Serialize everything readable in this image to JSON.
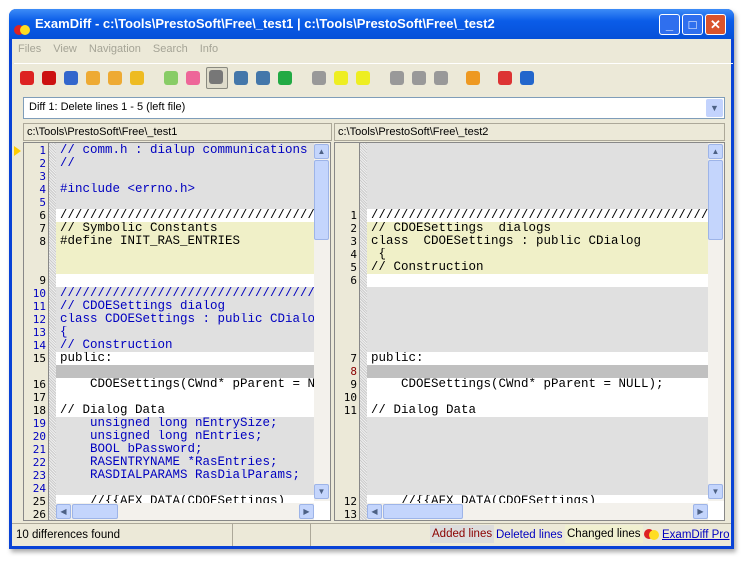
{
  "title": "ExamDiff - c:\\Tools\\PrestoSoft\\Free\\_test1   |   c:\\Tools\\PrestoSoft\\Free\\_test2",
  "menu": [
    "Files",
    "View",
    "Navigation",
    "Search",
    "Info"
  ],
  "toolbar": [
    "open-files-icon",
    "cherries-icon",
    "swap-icon",
    "edit-left-icon",
    "edit-right-icon",
    "save-icon",
    "layout-1-icon",
    "layout-2-icon",
    "layout-split-vertical-icon",
    "layout-split-horizontal-icon",
    "layout-4-icon",
    "colors-icon",
    "first-diff-icon",
    "current-diff-icon",
    "next-diff-icon",
    "find-icon",
    "find-next-icon",
    "find-prev-icon",
    "options-icon",
    "exit-icon",
    "info-icon"
  ],
  "diff_combo": "Diff 1: Delete lines 1 - 5 (left file)",
  "left_header": "c:\\Tools\\PrestoSoft\\Free\\_test1",
  "right_header": "c:\\Tools\\PrestoSoft\\Free\\_test2",
  "colors": {
    "deleted": "#e0e0e0",
    "changed": "#f0f0c8",
    "normal": "#ffffff",
    "placeholder": "#c0c0c0",
    "deleted_text": "#0000c0",
    "added_text": "#8b0000"
  },
  "left_rows": [
    [
      "1",
      "// comm.h : dialup communications",
      "del"
    ],
    [
      "2",
      "//",
      "del"
    ],
    [
      "3",
      "",
      "del"
    ],
    [
      "4",
      "#include <errno.h>",
      "del"
    ],
    [
      "5",
      "",
      "del"
    ],
    [
      "6",
      "////////////////////////////////////////",
      "norm"
    ],
    [
      "7",
      "// Symbolic Constants",
      "chg"
    ],
    [
      "8",
      "#define INIT_RAS_ENTRIES",
      "chg"
    ],
    [
      "",
      "",
      "chg"
    ],
    [
      "",
      "",
      "chg"
    ],
    [
      "9",
      "",
      "norm"
    ],
    [
      "10",
      "////////////////////////////////////////",
      "del"
    ],
    [
      "11",
      "// CDOESettings dialog",
      "del"
    ],
    [
      "12",
      "class CDOESettings : public CDialog",
      "del"
    ],
    [
      "13",
      "{",
      "del"
    ],
    [
      "14",
      "// Construction",
      "del"
    ],
    [
      "15",
      "public:",
      "norm"
    ],
    [
      "",
      "",
      "ph"
    ],
    [
      "16",
      "    CDOESettings(CWnd* pParent = NULL);",
      "norm"
    ],
    [
      "17",
      "",
      "norm"
    ],
    [
      "18",
      "// Dialog Data",
      "norm"
    ],
    [
      "19",
      "    unsigned long nEntrySize;",
      "del"
    ],
    [
      "20",
      "    unsigned long nEntries;",
      "del"
    ],
    [
      "21",
      "    BOOL bPassword;",
      "del"
    ],
    [
      "22",
      "    RASENTRYNAME *RasEntries;",
      "del"
    ],
    [
      "23",
      "    RASDIALPARAMS RasDialParams;",
      "del"
    ],
    [
      "24",
      "",
      "del"
    ],
    [
      "25",
      "    //{{AFX_DATA(CDOESettings)",
      "norm"
    ],
    [
      "26",
      "",
      "norm"
    ]
  ],
  "right_rows": [
    [
      "",
      "",
      "gap"
    ],
    [
      "",
      "",
      "gap"
    ],
    [
      "",
      "",
      "gap"
    ],
    [
      "",
      "",
      "gap"
    ],
    [
      "",
      "",
      "gap"
    ],
    [
      "1",
      "////////////////////////////////////////////////",
      "norm"
    ],
    [
      "2",
      "// CDOESettings  dialogs",
      "chg"
    ],
    [
      "3",
      "class  CDOESettings : public CDialog",
      "chg"
    ],
    [
      "4",
      " {",
      "chg"
    ],
    [
      "5",
      "// Construction",
      "chg"
    ],
    [
      "6",
      "",
      "norm"
    ],
    [
      "",
      "",
      "gap"
    ],
    [
      "",
      "",
      "gap"
    ],
    [
      "",
      "",
      "gap"
    ],
    [
      "",
      "",
      "gap"
    ],
    [
      "",
      "",
      "gap"
    ],
    [
      "7",
      "public:",
      "norm"
    ],
    [
      "8",
      "",
      "add"
    ],
    [
      "9",
      "    CDOESettings(CWnd* pParent = NULL);",
      "norm"
    ],
    [
      "10",
      "",
      "norm"
    ],
    [
      "11",
      "// Dialog Data",
      "norm"
    ],
    [
      "",
      "",
      "gap"
    ],
    [
      "",
      "",
      "gap"
    ],
    [
      "",
      "",
      "gap"
    ],
    [
      "",
      "",
      "gap"
    ],
    [
      "",
      "",
      "gap"
    ],
    [
      "",
      "",
      "gap"
    ],
    [
      "12",
      "    //{{AFX_DATA(CDOESettings)",
      "norm"
    ],
    [
      "13",
      "",
      "norm"
    ]
  ],
  "status": {
    "message": "10 differences found",
    "added": "Added lines",
    "deleted": "Deleted lines",
    "changed": "Changed lines",
    "link": "ExamDiff Pro"
  }
}
